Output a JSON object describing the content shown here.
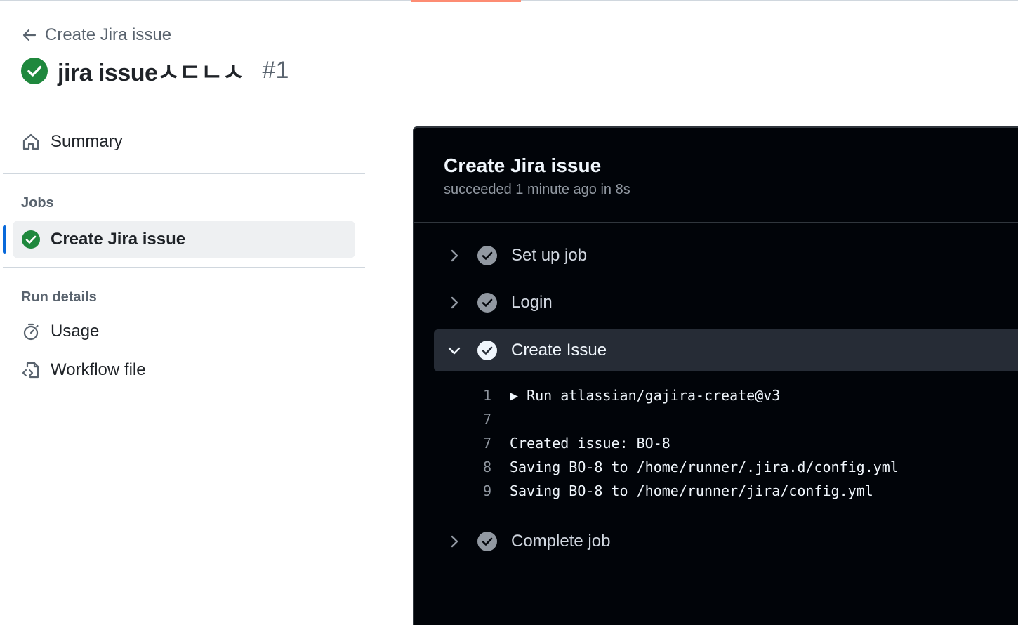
{
  "header": {
    "back_label": "Create Jira issue",
    "run_name": "jira issueㅅㄷㄴㅅ",
    "run_number": "#1"
  },
  "sidebar": {
    "summary_label": "Summary",
    "jobs_heading": "Jobs",
    "selected_job": "Create Jira issue",
    "run_details_heading": "Run details",
    "usage_label": "Usage",
    "workflow_file_label": "Workflow file"
  },
  "job_panel": {
    "title": "Create Jira issue",
    "status_text": "succeeded 1 minute ago in 8s",
    "steps": [
      {
        "label": "Set up job",
        "expanded": false
      },
      {
        "label": "Login",
        "expanded": false
      },
      {
        "label": "Create Issue",
        "expanded": true
      },
      {
        "label": "Complete job",
        "expanded": false
      }
    ],
    "log_lines": [
      {
        "num": "1",
        "text": "▶ Run atlassian/gajira-create@v3"
      },
      {
        "num": "7",
        "text": ""
      },
      {
        "num": "7",
        "text": "Created issue: BO-8"
      },
      {
        "num": "8",
        "text": "Saving BO-8 to /home/runner/.jira.d/config.yml"
      },
      {
        "num": "9",
        "text": "Saving BO-8 to /home/runner/jira/config.yml"
      }
    ]
  },
  "colors": {
    "success": "#1f883d",
    "accent_underline": "#fd8c73",
    "selected_bar": "#0969da",
    "panel_bg": "#010409"
  }
}
